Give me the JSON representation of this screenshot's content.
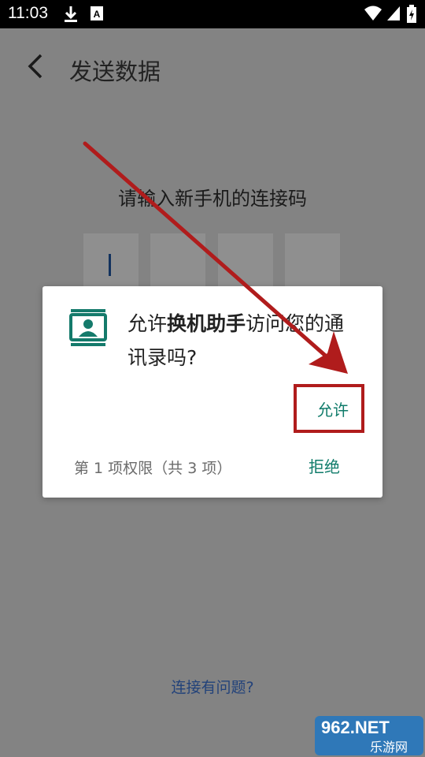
{
  "status_bar": {
    "time": "11:03",
    "icons": [
      "download-icon",
      "a-notification-icon",
      "wifi-icon",
      "signal-icon",
      "battery-charging-icon"
    ]
  },
  "app": {
    "title": "发送数据",
    "prompt": "请输入新手机的连接码",
    "code_boxes": 4,
    "help_link": "连接有问题?"
  },
  "dialog": {
    "icon": "contacts-card-icon",
    "message_prefix": "允许",
    "app_name": "换机助手",
    "message_suffix": "访问您的通讯录吗?",
    "allow_label": "允许",
    "deny_label": "拒绝",
    "permission_count": "第 1 项权限（共 3 项）"
  },
  "annotation": {
    "arrow_color": "#b01c1c"
  },
  "watermark": {
    "line1": "962.NET",
    "line2": "乐游网"
  },
  "colors": {
    "accent": "#0f7b6a",
    "highlight": "#b01c1c",
    "scrim": "#838383"
  }
}
